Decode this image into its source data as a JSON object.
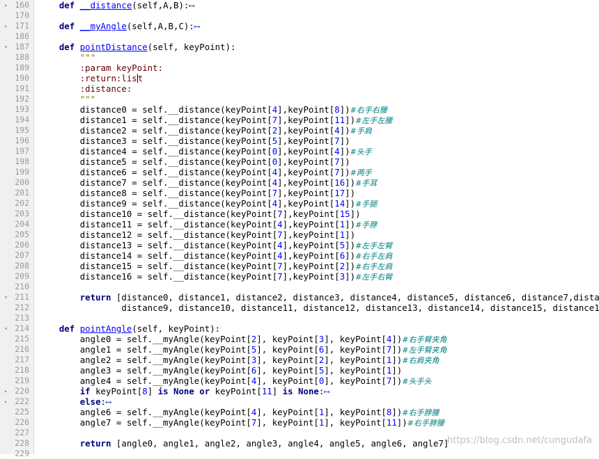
{
  "watermark": "https://blog.csdn.net/cungudafa",
  "lines": [
    {
      "n": "160",
      "fold": "▸",
      "indent": "    ",
      "tokens": [
        {
          "t": "kw",
          "v": "def"
        },
        {
          "t": "",
          "v": " "
        },
        {
          "t": "fn",
          "v": "__distance"
        },
        {
          "t": "",
          "v": "(self,A,B):"
        },
        {
          "t": "arrow",
          "v": "⟷"
        }
      ]
    },
    {
      "n": "170",
      "fold": "",
      "indent": "",
      "tokens": []
    },
    {
      "n": "171",
      "fold": "▸",
      "indent": "    ",
      "tokens": [
        {
          "t": "kw",
          "v": "def"
        },
        {
          "t": "",
          "v": " "
        },
        {
          "t": "fn",
          "v": "__myAngle"
        },
        {
          "t": "",
          "v": "(self,A,B,C):"
        },
        {
          "t": "arrow",
          "v": "⟷"
        }
      ]
    },
    {
      "n": "186",
      "fold": "",
      "indent": "",
      "tokens": []
    },
    {
      "n": "187",
      "fold": "▾",
      "indent": "    ",
      "tokens": [
        {
          "t": "kw",
          "v": "def"
        },
        {
          "t": "",
          "v": " "
        },
        {
          "t": "fn",
          "v": "pointDistance"
        },
        {
          "t": "",
          "v": "(self, keyPoint):"
        }
      ]
    },
    {
      "n": "188",
      "fold": "",
      "indent": "        ",
      "tokens": [
        {
          "t": "str",
          "v": "\"\"\""
        }
      ]
    },
    {
      "n": "189",
      "fold": "",
      "indent": "        ",
      "tokens": [
        {
          "t": "doc",
          "v": ":param keyPoint:"
        }
      ]
    },
    {
      "n": "190",
      "fold": "",
      "indent": "        ",
      "tokens": [
        {
          "t": "doc",
          "v": ":return:lis"
        },
        {
          "t": "cursor",
          "v": ""
        },
        {
          "t": "doc",
          "v": "t"
        }
      ]
    },
    {
      "n": "191",
      "fold": "",
      "indent": "        ",
      "tokens": [
        {
          "t": "doc",
          "v": ":distance:"
        }
      ]
    },
    {
      "n": "192",
      "fold": "",
      "indent": "        ",
      "tokens": [
        {
          "t": "str",
          "v": "\"\"\""
        }
      ]
    },
    {
      "n": "193",
      "fold": "",
      "indent": "        ",
      "tokens": [
        {
          "t": "",
          "v": "distance0 = self.__distance(keyPoint["
        },
        {
          "t": "num",
          "v": "4"
        },
        {
          "t": "",
          "v": "],keyPoint["
        },
        {
          "t": "num",
          "v": "8"
        },
        {
          "t": "",
          "v": "])"
        },
        {
          "t": "cmt",
          "v": "#右手右腰"
        }
      ]
    },
    {
      "n": "194",
      "fold": "",
      "indent": "        ",
      "tokens": [
        {
          "t": "",
          "v": "distance1 = self.__distance(keyPoint["
        },
        {
          "t": "num",
          "v": "7"
        },
        {
          "t": "",
          "v": "],keyPoint["
        },
        {
          "t": "num",
          "v": "11"
        },
        {
          "t": "",
          "v": "])"
        },
        {
          "t": "cmt",
          "v": "#左手左腰"
        }
      ]
    },
    {
      "n": "195",
      "fold": "",
      "indent": "        ",
      "tokens": [
        {
          "t": "",
          "v": "distance2 = self.__distance(keyPoint["
        },
        {
          "t": "num",
          "v": "2"
        },
        {
          "t": "",
          "v": "],keyPoint["
        },
        {
          "t": "num",
          "v": "4"
        },
        {
          "t": "",
          "v": "])"
        },
        {
          "t": "cmt",
          "v": "#手肩"
        }
      ]
    },
    {
      "n": "196",
      "fold": "",
      "indent": "        ",
      "tokens": [
        {
          "t": "",
          "v": "distance3 = self.__distance(keyPoint["
        },
        {
          "t": "num",
          "v": "5"
        },
        {
          "t": "",
          "v": "],keyPoint["
        },
        {
          "t": "num",
          "v": "7"
        },
        {
          "t": "",
          "v": "])"
        }
      ]
    },
    {
      "n": "197",
      "fold": "",
      "indent": "        ",
      "tokens": [
        {
          "t": "",
          "v": "distance4 = self.__distance(keyPoint["
        },
        {
          "t": "num",
          "v": "0"
        },
        {
          "t": "",
          "v": "],keyPoint["
        },
        {
          "t": "num",
          "v": "4"
        },
        {
          "t": "",
          "v": "])"
        },
        {
          "t": "cmt",
          "v": "#头手"
        }
      ]
    },
    {
      "n": "198",
      "fold": "",
      "indent": "        ",
      "tokens": [
        {
          "t": "",
          "v": "distance5 = self.__distance(keyPoint["
        },
        {
          "t": "num",
          "v": "0"
        },
        {
          "t": "",
          "v": "],keyPoint["
        },
        {
          "t": "num",
          "v": "7"
        },
        {
          "t": "",
          "v": "])"
        }
      ]
    },
    {
      "n": "199",
      "fold": "",
      "indent": "        ",
      "tokens": [
        {
          "t": "",
          "v": "distance6 = self.__distance(keyPoint["
        },
        {
          "t": "num",
          "v": "4"
        },
        {
          "t": "",
          "v": "],keyPoint["
        },
        {
          "t": "num",
          "v": "7"
        },
        {
          "t": "",
          "v": "])"
        },
        {
          "t": "cmt",
          "v": "#两手"
        }
      ]
    },
    {
      "n": "200",
      "fold": "",
      "indent": "        ",
      "tokens": [
        {
          "t": "",
          "v": "distance7 = self.__distance(keyPoint["
        },
        {
          "t": "num",
          "v": "4"
        },
        {
          "t": "",
          "v": "],keyPoint["
        },
        {
          "t": "num",
          "v": "16"
        },
        {
          "t": "",
          "v": "])"
        },
        {
          "t": "cmt",
          "v": "#手耳"
        }
      ]
    },
    {
      "n": "201",
      "fold": "",
      "indent": "        ",
      "tokens": [
        {
          "t": "",
          "v": "distance8 = self.__distance(keyPoint["
        },
        {
          "t": "num",
          "v": "7"
        },
        {
          "t": "",
          "v": "],keyPoint["
        },
        {
          "t": "num",
          "v": "17"
        },
        {
          "t": "",
          "v": "])"
        }
      ]
    },
    {
      "n": "202",
      "fold": "",
      "indent": "        ",
      "tokens": [
        {
          "t": "",
          "v": "distance9 = self.__distance(keyPoint["
        },
        {
          "t": "num",
          "v": "4"
        },
        {
          "t": "",
          "v": "],keyPoint["
        },
        {
          "t": "num",
          "v": "14"
        },
        {
          "t": "",
          "v": "])"
        },
        {
          "t": "cmt",
          "v": "#手腿"
        }
      ]
    },
    {
      "n": "203",
      "fold": "",
      "indent": "        ",
      "tokens": [
        {
          "t": "",
          "v": "distance10 = self.__distance(keyPoint["
        },
        {
          "t": "num",
          "v": "7"
        },
        {
          "t": "",
          "v": "],keyPoint["
        },
        {
          "t": "num",
          "v": "15"
        },
        {
          "t": "",
          "v": "])"
        }
      ]
    },
    {
      "n": "204",
      "fold": "",
      "indent": "        ",
      "tokens": [
        {
          "t": "",
          "v": "distance11 = self.__distance(keyPoint["
        },
        {
          "t": "num",
          "v": "4"
        },
        {
          "t": "",
          "v": "],keyPoint["
        },
        {
          "t": "num",
          "v": "1"
        },
        {
          "t": "",
          "v": "])"
        },
        {
          "t": "cmt",
          "v": "#手脖"
        }
      ]
    },
    {
      "n": "205",
      "fold": "",
      "indent": "        ",
      "tokens": [
        {
          "t": "",
          "v": "distance12 = self.__distance(keyPoint["
        },
        {
          "t": "num",
          "v": "7"
        },
        {
          "t": "",
          "v": "],keyPoint["
        },
        {
          "t": "num",
          "v": "1"
        },
        {
          "t": "",
          "v": "])"
        }
      ]
    },
    {
      "n": "206",
      "fold": "",
      "indent": "        ",
      "tokens": [
        {
          "t": "",
          "v": "distance13 = self.__distance(keyPoint["
        },
        {
          "t": "num",
          "v": "4"
        },
        {
          "t": "",
          "v": "],keyPoint["
        },
        {
          "t": "num",
          "v": "5"
        },
        {
          "t": "",
          "v": "])"
        },
        {
          "t": "cmt",
          "v": "#左手左臂"
        }
      ]
    },
    {
      "n": "207",
      "fold": "",
      "indent": "        ",
      "tokens": [
        {
          "t": "",
          "v": "distance14 = self.__distance(keyPoint["
        },
        {
          "t": "num",
          "v": "4"
        },
        {
          "t": "",
          "v": "],keyPoint["
        },
        {
          "t": "num",
          "v": "6"
        },
        {
          "t": "",
          "v": "])"
        },
        {
          "t": "cmt",
          "v": "#右手左肩"
        }
      ]
    },
    {
      "n": "208",
      "fold": "",
      "indent": "        ",
      "tokens": [
        {
          "t": "",
          "v": "distance15 = self.__distance(keyPoint["
        },
        {
          "t": "num",
          "v": "7"
        },
        {
          "t": "",
          "v": "],keyPoint["
        },
        {
          "t": "num",
          "v": "2"
        },
        {
          "t": "",
          "v": "])"
        },
        {
          "t": "cmt",
          "v": "#右手左肩"
        }
      ]
    },
    {
      "n": "209",
      "fold": "",
      "indent": "        ",
      "tokens": [
        {
          "t": "",
          "v": "distance16 = self.__distance(keyPoint["
        },
        {
          "t": "num",
          "v": "7"
        },
        {
          "t": "",
          "v": "],keyPoint["
        },
        {
          "t": "num",
          "v": "3"
        },
        {
          "t": "",
          "v": "])"
        },
        {
          "t": "cmt",
          "v": "#左手右臂"
        }
      ]
    },
    {
      "n": "210",
      "fold": "",
      "indent": "",
      "tokens": []
    },
    {
      "n": "211",
      "fold": "▾",
      "indent": "        ",
      "tokens": [
        {
          "t": "kw",
          "v": "return"
        },
        {
          "t": "",
          "v": " [distance0, distance1, distance2, distance3, distance4, distance5, distance6, distance7,distance8,"
        }
      ]
    },
    {
      "n": "212",
      "fold": "",
      "indent": "                ",
      "tokens": [
        {
          "t": "",
          "v": "distance9, distance10, distance11, distance12, distance13, distance14, distance15, distance16]"
        }
      ]
    },
    {
      "n": "213",
      "fold": "",
      "indent": "",
      "tokens": []
    },
    {
      "n": "214",
      "fold": "▾",
      "indent": "    ",
      "tokens": [
        {
          "t": "kw",
          "v": "def"
        },
        {
          "t": "",
          "v": " "
        },
        {
          "t": "fn",
          "v": "pointAngle"
        },
        {
          "t": "",
          "v": "(self, keyPoint):"
        }
      ]
    },
    {
      "n": "215",
      "fold": "",
      "indent": "        ",
      "tokens": [
        {
          "t": "",
          "v": "angle0 = self.__myAngle(keyPoint["
        },
        {
          "t": "num",
          "v": "2"
        },
        {
          "t": "",
          "v": "], keyPoint["
        },
        {
          "t": "num",
          "v": "3"
        },
        {
          "t": "",
          "v": "], keyPoint["
        },
        {
          "t": "num",
          "v": "4"
        },
        {
          "t": "",
          "v": "])"
        },
        {
          "t": "cmt",
          "v": "#右手臂夹角"
        }
      ]
    },
    {
      "n": "216",
      "fold": "",
      "indent": "        ",
      "tokens": [
        {
          "t": "",
          "v": "angle1 = self.__myAngle(keyPoint["
        },
        {
          "t": "num",
          "v": "5"
        },
        {
          "t": "",
          "v": "], keyPoint["
        },
        {
          "t": "num",
          "v": "6"
        },
        {
          "t": "",
          "v": "], keyPoint["
        },
        {
          "t": "num",
          "v": "7"
        },
        {
          "t": "",
          "v": "])"
        },
        {
          "t": "cmt",
          "v": "#左手臂夹角"
        }
      ]
    },
    {
      "n": "217",
      "fold": "",
      "indent": "        ",
      "tokens": [
        {
          "t": "",
          "v": "angle2 = self.__myAngle(keyPoint["
        },
        {
          "t": "num",
          "v": "3"
        },
        {
          "t": "",
          "v": "], keyPoint["
        },
        {
          "t": "num",
          "v": "2"
        },
        {
          "t": "",
          "v": "], keyPoint["
        },
        {
          "t": "num",
          "v": "1"
        },
        {
          "t": "",
          "v": "])"
        },
        {
          "t": "cmt",
          "v": "#右肩夹角"
        }
      ]
    },
    {
      "n": "218",
      "fold": "",
      "indent": "        ",
      "tokens": [
        {
          "t": "",
          "v": "angle3 = self.__myAngle(keyPoint["
        },
        {
          "t": "num",
          "v": "6"
        },
        {
          "t": "",
          "v": "], keyPoint["
        },
        {
          "t": "num",
          "v": "5"
        },
        {
          "t": "",
          "v": "], keyPoint["
        },
        {
          "t": "num",
          "v": "1"
        },
        {
          "t": "",
          "v": "])"
        }
      ]
    },
    {
      "n": "219",
      "fold": "",
      "indent": "        ",
      "tokens": [
        {
          "t": "",
          "v": "angle4 = self.__myAngle(keyPoint["
        },
        {
          "t": "num",
          "v": "4"
        },
        {
          "t": "",
          "v": "], keyPoint["
        },
        {
          "t": "num",
          "v": "0"
        },
        {
          "t": "",
          "v": "], keyPoint["
        },
        {
          "t": "num",
          "v": "7"
        },
        {
          "t": "",
          "v": "])"
        },
        {
          "t": "cmt",
          "v": "#头手头"
        }
      ]
    },
    {
      "n": "220",
      "fold": "▸",
      "indent": "        ",
      "tokens": [
        {
          "t": "kw",
          "v": "if"
        },
        {
          "t": "",
          "v": " keyPoint["
        },
        {
          "t": "num",
          "v": "8"
        },
        {
          "t": "",
          "v": "] "
        },
        {
          "t": "kw",
          "v": "is None or"
        },
        {
          "t": "",
          "v": " keyPoint["
        },
        {
          "t": "num",
          "v": "11"
        },
        {
          "t": "",
          "v": "] "
        },
        {
          "t": "kw",
          "v": "is None"
        },
        {
          "t": "",
          "v": ":"
        },
        {
          "t": "arrow",
          "v": "⟷"
        }
      ]
    },
    {
      "n": "222",
      "fold": "▸",
      "indent": "        ",
      "tokens": [
        {
          "t": "kw",
          "v": "else"
        },
        {
          "t": "",
          "v": ":"
        },
        {
          "t": "arrow",
          "v": "⟷"
        }
      ]
    },
    {
      "n": "225",
      "fold": "",
      "indent": "        ",
      "tokens": [
        {
          "t": "",
          "v": "angle6 = self.__myAngle(keyPoint["
        },
        {
          "t": "num",
          "v": "4"
        },
        {
          "t": "",
          "v": "], keyPoint["
        },
        {
          "t": "num",
          "v": "1"
        },
        {
          "t": "",
          "v": "], keyPoint["
        },
        {
          "t": "num",
          "v": "8"
        },
        {
          "t": "",
          "v": "])"
        },
        {
          "t": "cmt",
          "v": "#右手脖腰"
        }
      ]
    },
    {
      "n": "226",
      "fold": "",
      "indent": "        ",
      "tokens": [
        {
          "t": "",
          "v": "angle7 = self.__myAngle(keyPoint["
        },
        {
          "t": "num",
          "v": "7"
        },
        {
          "t": "",
          "v": "], keyPoint["
        },
        {
          "t": "num",
          "v": "1"
        },
        {
          "t": "",
          "v": "], keyPoint["
        },
        {
          "t": "num",
          "v": "11"
        },
        {
          "t": "",
          "v": "])"
        },
        {
          "t": "cmt",
          "v": "#右手脖腰"
        }
      ]
    },
    {
      "n": "227",
      "fold": "",
      "indent": "",
      "tokens": []
    },
    {
      "n": "228",
      "fold": "",
      "indent": "        ",
      "tokens": [
        {
          "t": "kw",
          "v": "return"
        },
        {
          "t": "",
          "v": " [angle0, angle1, angle2, angle3, angle4, angle5, angle6, angle7]"
        }
      ]
    },
    {
      "n": "229",
      "fold": "",
      "indent": "",
      "tokens": []
    }
  ]
}
